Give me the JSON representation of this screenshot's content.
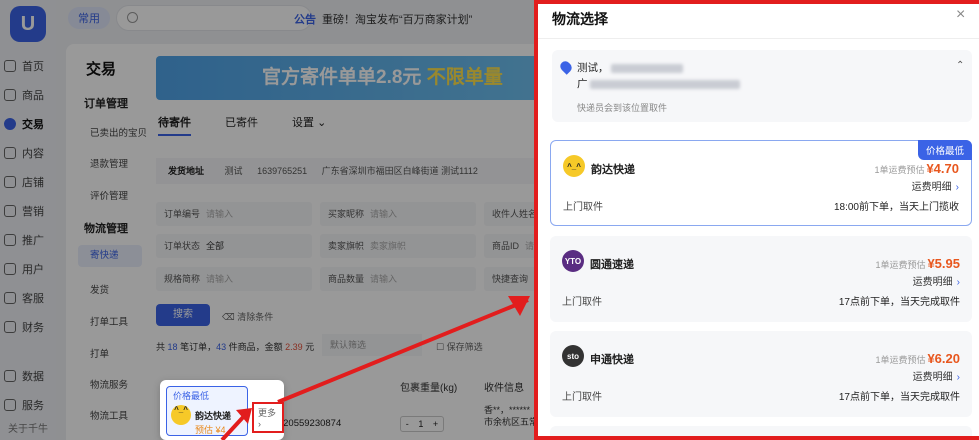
{
  "nav": {
    "logo": "U",
    "items": [
      "首页",
      "商品",
      "交易",
      "内容",
      "店铺",
      "营销",
      "推广",
      "用户",
      "客服",
      "财务",
      "数据",
      "服务"
    ],
    "active": "交易",
    "footer": "关于千牛"
  },
  "topbar": {
    "pill": "常用",
    "announce_tag": "公告",
    "announce_text": "重磅！淘宝发布“百万商家计划”"
  },
  "sub_sidebar": {
    "title": "交易",
    "order_mgmt": "订单管理",
    "order_items": [
      "已卖出的宝贝",
      "退款管理",
      "评价管理"
    ],
    "logistics_mgmt": "物流管理",
    "logistics_items": [
      "寄快递",
      "发货",
      "打单工具",
      "打单",
      "物流服务",
      "物流工具"
    ]
  },
  "main": {
    "banner_prefix": "官方寄件单单2.8元",
    "banner_highlight": "不限单量",
    "tabs": [
      "待寄件",
      "已寄件",
      "设置"
    ],
    "address_label": "发货地址",
    "address_name": "测试",
    "address_phone": "1639765251",
    "address_detail": "广东省深圳市福田区白峰街道 测试1112",
    "fields": {
      "order_no": "订单编号",
      "order_no_ph": "请输入",
      "buyer_nick": "买家昵称",
      "buyer_nick_ph": "请输入",
      "recv_name": "收件人姓名",
      "order_status": "订单状态",
      "order_status_val": "全部",
      "seller_flag": "卖家旗帜",
      "seller_flag_ph": "卖家旗帜",
      "item_id": "商品ID",
      "item_id_ph": "请输入",
      "spec": "规格简称",
      "spec_ph": "请输入",
      "item_qty": "商品数量",
      "item_qty_ph": "请输入",
      "express_query": "快捷查询"
    },
    "search_btn": "搜索",
    "clear": "清除条件",
    "summary": {
      "p1": "共",
      "orders": "18",
      "p2": "笔订单，",
      "goods": "43",
      "p3": "件商品，金额",
      "amount": "2.39",
      "p4": "元"
    },
    "default_filter": "默认筛选",
    "keep_filter": "保存筛选",
    "table_headers": [
      "包裹重量(kg)",
      "收件信息"
    ],
    "order_id": "337920559230874",
    "stepper": [
      "-",
      "1",
      "+"
    ],
    "recv_lines": [
      "香**，******",
      "市余杭区五常"
    ]
  },
  "popup": {
    "badge": "价格最低",
    "name": "韵达快递",
    "est": "预估 ¥4",
    "more": "更多 ›"
  },
  "drawer": {
    "title": "物流选择",
    "close": "×",
    "address": {
      "name": "测试，",
      "line2_prefix": "广",
      "note": "快递员会到该位置取件"
    },
    "carriers": [
      {
        "name": "韵达快递",
        "logo": "^_^",
        "est_label": "1单运费预估",
        "price": "¥4.70",
        "detail": "运费明细",
        "pickup": "上门取件",
        "time": "18:00前下单，当天上门揽收",
        "best": "价格最低",
        "color": "#f6c928"
      },
      {
        "name": "圆通速递",
        "logo": "YTO",
        "est_label": "1单运费预估",
        "price": "¥5.95",
        "detail": "运费明细",
        "pickup": "上门取件",
        "time": "17点前下单，当天完成取件",
        "color": "#5a2d82"
      },
      {
        "name": "申通快递",
        "logo": "sto",
        "est_label": "1单运费预估",
        "price": "¥6.20",
        "detail": "运费明细",
        "pickup": "上门取件",
        "time": "17点前下单，当天完成取件",
        "color": "#333333"
      }
    ]
  },
  "colors": {
    "accent": "#3b63e6",
    "price": "#e8571e",
    "annotation_red": "#e21d1d"
  }
}
